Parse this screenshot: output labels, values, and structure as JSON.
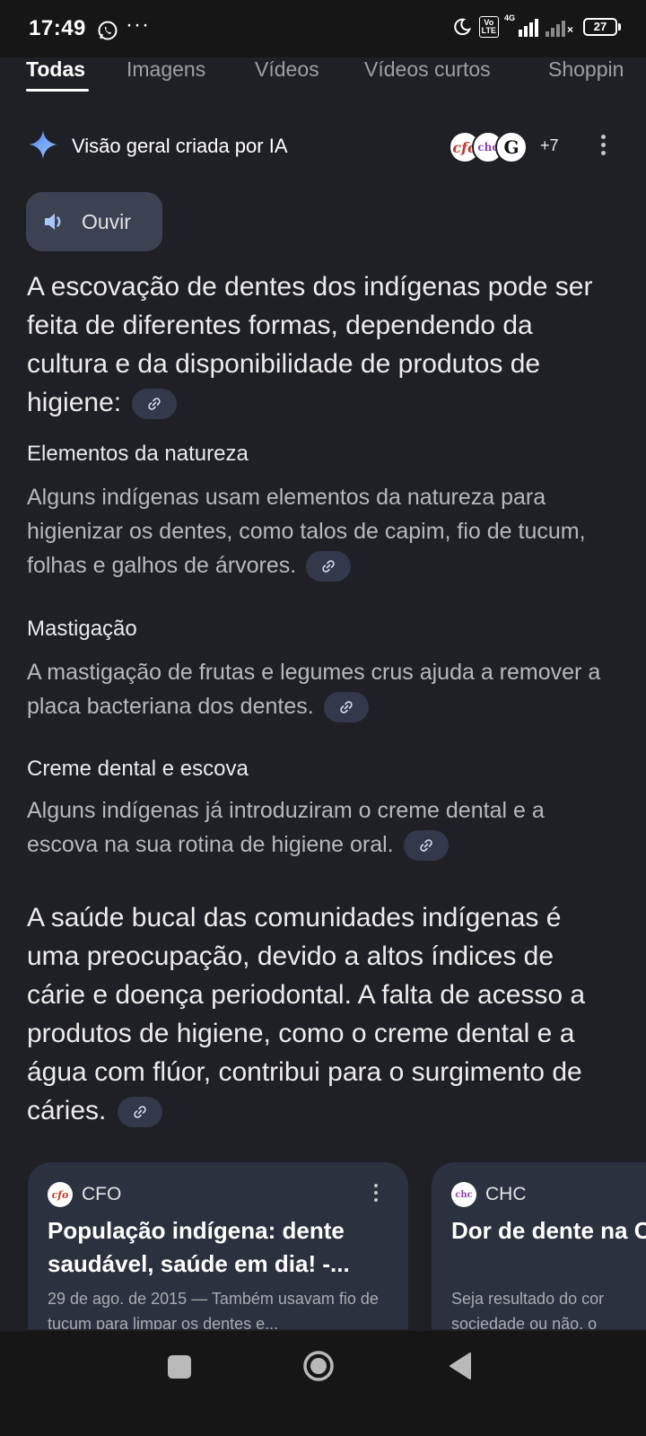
{
  "status_bar": {
    "time": "17:49",
    "dots": "···",
    "volte": "Vo\nLTE",
    "network": "4G",
    "battery": "27"
  },
  "tabs": [
    {
      "label": "Todas",
      "active": true
    },
    {
      "label": "Imagens",
      "active": false
    },
    {
      "label": "Vídeos",
      "active": false
    },
    {
      "label": "Vídeos curtos",
      "active": false
    },
    {
      "label": "Shoppin",
      "active": false
    }
  ],
  "ai_overview": {
    "title": "Visão geral criada por IA",
    "more_sources": "+7",
    "listen_label": "Ouvir",
    "intro": "A escovação de dentes dos indígenas pode ser feita de diferentes formas, dependendo da cultura e da disponibilidade de produtos de higiene:",
    "sections": [
      {
        "title": "Elementos da natureza",
        "text": "Alguns indígenas usam elementos da natureza para higienizar os dentes, como talos de capim, fio de tucum, folhas e galhos de árvores."
      },
      {
        "title": "Mastigação",
        "text": "A mastigação de frutas e legumes crus ajuda a remover a placa bacteriana dos dentes."
      },
      {
        "title": "Creme dental e escova",
        "text": "Alguns indígenas já introduziram o creme dental e a escova na sua rotina de higiene oral."
      }
    ],
    "conclusion": "A saúde bucal das comunidades indígenas é uma preocupação, devido a altos índices de cárie e doença periodontal. A falta de acesso a produtos de higiene, como o creme dental e a água com flúor, contribui para o surgimento de cáries."
  },
  "source_cards": [
    {
      "source": "CFO",
      "favicon_text": "cfo",
      "title": "População indígena: dente saudável, saúde em dia! -...",
      "snippet": "29 de ago. de 2015 — Também usavam fio de tucum para limpar os dentes e..."
    },
    {
      "source": "CHC",
      "favicon_text": "chc",
      "title": "Dor de dente na CHC",
      "snippet": "Seja resultado do cor sociedade ou não, o"
    }
  ],
  "colors": {
    "background": "#1f2025",
    "chip": "#33384a",
    "card": "#2c313f",
    "sparkle": "#8ab4f8"
  }
}
